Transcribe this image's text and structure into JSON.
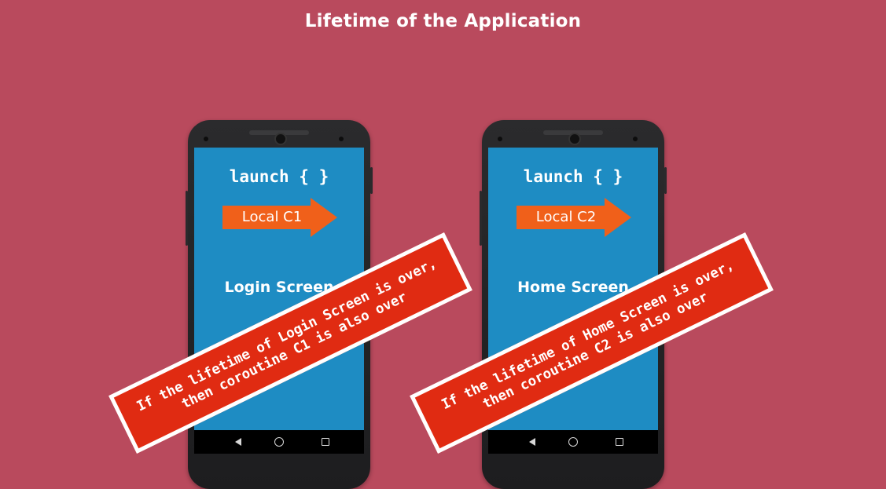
{
  "title": "Lifetime of the Application",
  "phones": [
    {
      "launch_code": "launch { }",
      "arrow_label": "Local C1",
      "screen_name": "Login Screen",
      "banner": "If the lifetime of Login Screen is over,\nthen coroutine C1 is also over"
    },
    {
      "launch_code": "launch { }",
      "arrow_label": "Local C2",
      "screen_name": "Home Screen",
      "banner": "If the lifetime of Home Screen is over,\nthen coroutine C2 is also over"
    }
  ],
  "nav_icons": [
    "back-triangle-icon",
    "home-circle-icon",
    "recents-square-icon"
  ],
  "colors": {
    "background": "#b94a5d",
    "screen": "#1e8cc3",
    "arrow": "#f0601a",
    "banner": "#e02b12",
    "text": "#ffffff"
  }
}
